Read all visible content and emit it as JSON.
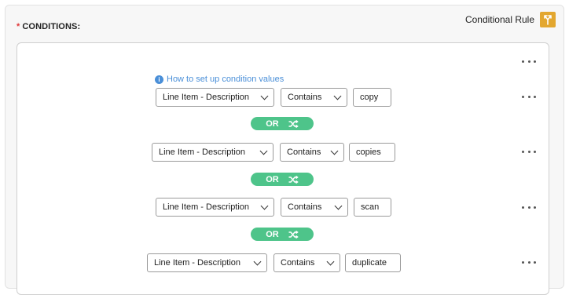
{
  "section": {
    "required_mark": "*",
    "title": "CONDITIONS:"
  },
  "rule": {
    "label": "Conditional Rule",
    "icon": "branch-icon",
    "icon_color": "#e3a72f"
  },
  "help": {
    "text": "How to set up condition values",
    "icon": "info-icon"
  },
  "conditions": [
    {
      "field": "Line Item - Description",
      "operator": "Contains",
      "value": "copy"
    },
    {
      "field": "Line Item - Description",
      "operator": "Contains",
      "value": "copies"
    },
    {
      "field": "Line Item - Description",
      "operator": "Contains",
      "value": "scan"
    },
    {
      "field": "Line Item - Description",
      "operator": "Contains",
      "value": "duplicate"
    }
  ],
  "connectors": [
    {
      "label": "OR",
      "icon": "shuffle-icon"
    },
    {
      "label": "OR",
      "icon": "shuffle-icon"
    },
    {
      "label": "OR",
      "icon": "shuffle-icon"
    }
  ],
  "colors": {
    "or_green": "#4ec48a",
    "link_blue": "#4a8fd8",
    "required_red": "#e0393a"
  }
}
